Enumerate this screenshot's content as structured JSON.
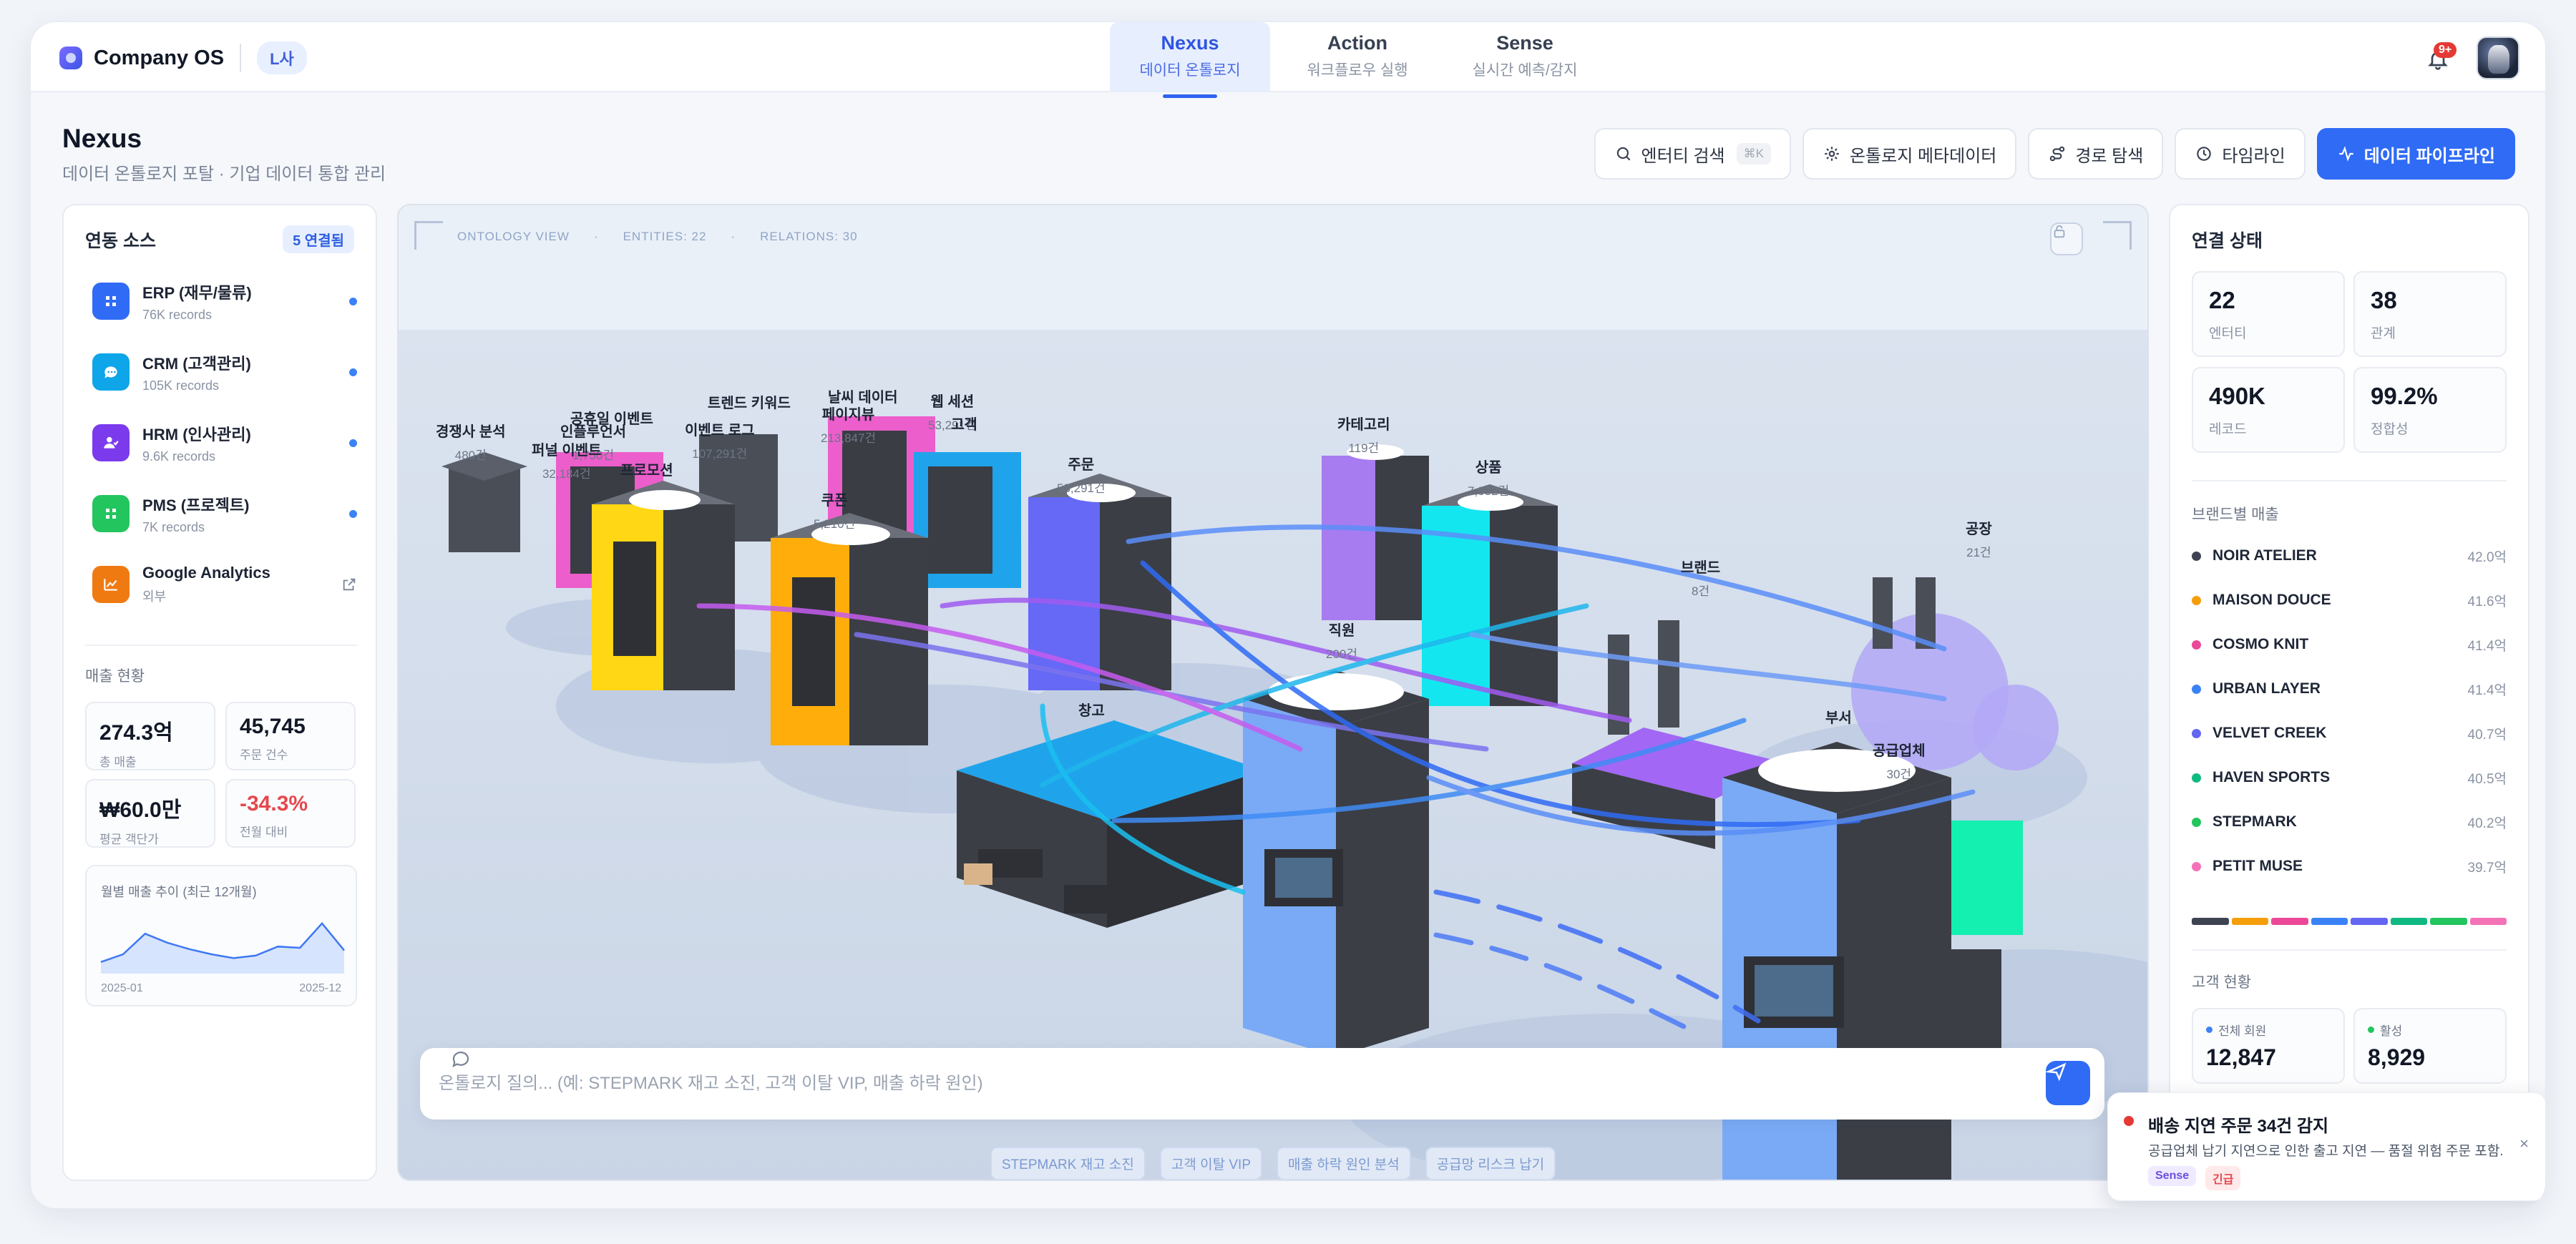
{
  "brand": {
    "name": "Company OS",
    "org": "L사"
  },
  "nav": {
    "tabs": [
      {
        "title": "Nexus",
        "subtitle": "데이터 온톨로지"
      },
      {
        "title": "Action",
        "subtitle": "워크플로우 실행"
      },
      {
        "title": "Sense",
        "subtitle": "실시간 예측/감지"
      }
    ]
  },
  "notifications": {
    "badge": "9+"
  },
  "header": {
    "title": "Nexus",
    "subtitle": "데이터 온톨로지 포탈 · 기업 데이터 통합 관리"
  },
  "toolbar": {
    "entity_search": "엔터티 검색",
    "shortcut": "⌘K",
    "ontology_meta": "온톨로지 메타데이터",
    "path_explore": "경로 탐색",
    "timeline": "타임라인",
    "pipeline": "데이터 파이프라인"
  },
  "left": {
    "title": "연동 소스",
    "badge": "5 연결됨",
    "sources": [
      {
        "name": "ERP (재무/물류)",
        "records": "76K records",
        "color": "#2f6bf5",
        "icon": "grid-icon"
      },
      {
        "name": "CRM (고객관리)",
        "records": "105K records",
        "color": "#0ea5e9",
        "icon": "chat-icon"
      },
      {
        "name": "HRM (인사관리)",
        "records": "9.6K records",
        "color": "#7c3aed",
        "icon": "people-icon"
      },
      {
        "name": "PMS (프로젝트)",
        "records": "7K records",
        "color": "#22c55e",
        "icon": "grid-icon"
      },
      {
        "name": "Google Analytics",
        "records": "외부",
        "color": "#f07a12",
        "icon": "analytics-icon"
      }
    ],
    "sales_title": "매출 현황",
    "kpis": [
      {
        "value": "274.3억",
        "label": "총 매출",
        "color": "#111826"
      },
      {
        "value": "45,745",
        "label": "주문 건수",
        "color": "#111826"
      },
      {
        "value": "₩60.0만",
        "label": "평균 객단가",
        "color": "#111826"
      },
      {
        "value": "-34.3%",
        "label": "전월 대비",
        "color": "#e5484d"
      }
    ],
    "trend": {
      "title": "월별 매출 추이 (최근 12개월)",
      "start": "2025-01",
      "end": "2025-12",
      "values": [
        0.18,
        0.3,
        0.62,
        0.48,
        0.38,
        0.3,
        0.24,
        0.28,
        0.42,
        0.4,
        0.78,
        0.36
      ]
    }
  },
  "scene": {
    "meta": [
      "ONTOLOGY VIEW",
      "·",
      "ENTITIES: 22",
      "·",
      "RELATIONS: 30"
    ],
    "labels": [
      {
        "name": "경쟁사 분석",
        "count": "480건"
      },
      {
        "name": "공휴일 이벤트",
        "count": ""
      },
      {
        "name": "인플루언서",
        "count": "1,750건"
      },
      {
        "name": "퍼널 이벤트",
        "count": "32,184건"
      },
      {
        "name": "프로모션",
        "count": ""
      },
      {
        "name": "트렌드 키워드",
        "count": ""
      },
      {
        "name": "이벤트 로그",
        "count": "107,291건"
      },
      {
        "name": "날씨 데이터",
        "count": ""
      },
      {
        "name": "페이지뷰",
        "count": "213,847건"
      },
      {
        "name": "웹 세션",
        "count": "53,291건"
      },
      {
        "name": "고객",
        "count": ""
      },
      {
        "name": "쿠폰",
        "count": "5,210건"
      },
      {
        "name": "주문",
        "count": "53,291건"
      },
      {
        "name": "카테고리",
        "count": "119건"
      },
      {
        "name": "상품",
        "count": "7,832건"
      },
      {
        "name": "브랜드",
        "count": "8건"
      },
      {
        "name": "공장",
        "count": "21건"
      },
      {
        "name": "직원",
        "count": "200건"
      },
      {
        "name": "창고",
        "count": ""
      },
      {
        "name": "부서",
        "count": ""
      },
      {
        "name": "공급업체",
        "count": "30건"
      }
    ],
    "chat_placeholder": "온톨로지 질의... (예: STEPMARK 재고 소진, 고객 이탈 VIP, 매출 하락 원인)",
    "chips": [
      "STEPMARK 재고 소진",
      "고객 이탈 VIP",
      "매출 하락 원인 분석",
      "공급망 리스크 납기"
    ]
  },
  "right": {
    "title": "연결 상태",
    "stats": [
      {
        "value": "22",
        "label": "엔터티"
      },
      {
        "value": "38",
        "label": "관계"
      },
      {
        "value": "490K",
        "label": "레코드"
      },
      {
        "value": "99.2%",
        "label": "정합성"
      }
    ],
    "brand_title": "브랜드별 매출",
    "brands": [
      {
        "name": "NOIR ATELIER",
        "value": "42.0억",
        "color": "#3d4350"
      },
      {
        "name": "MAISON DOUCE",
        "value": "41.6억",
        "color": "#f59e0b"
      },
      {
        "name": "COSMO KNIT",
        "value": "41.4억",
        "color": "#ec4899"
      },
      {
        "name": "URBAN LAYER",
        "value": "41.4억",
        "color": "#3b82f6"
      },
      {
        "name": "VELVET CREEK",
        "value": "40.7억",
        "color": "#6366f1"
      },
      {
        "name": "HAVEN SPORTS",
        "value": "40.5억",
        "color": "#10b981"
      },
      {
        "name": "STEPMARK",
        "value": "40.2억",
        "color": "#22c55e"
      },
      {
        "name": "PETIT MUSE",
        "value": "39.7억",
        "color": "#f472b6"
      }
    ],
    "customer_title": "고객 현황",
    "customers": [
      {
        "label": "전체 회원",
        "value": "12,847",
        "color": "#3b82f6"
      },
      {
        "label": "활성",
        "value": "8,929",
        "color": "#22c55e"
      }
    ]
  },
  "toast": {
    "title": "배송 지연 주문 34건 감지",
    "desc": "공급업체 납기 지연으로 인한 출고 지연 — 품절 위험 주문 포함.",
    "tags": [
      "Sense",
      "긴급"
    ],
    "close": "×"
  }
}
